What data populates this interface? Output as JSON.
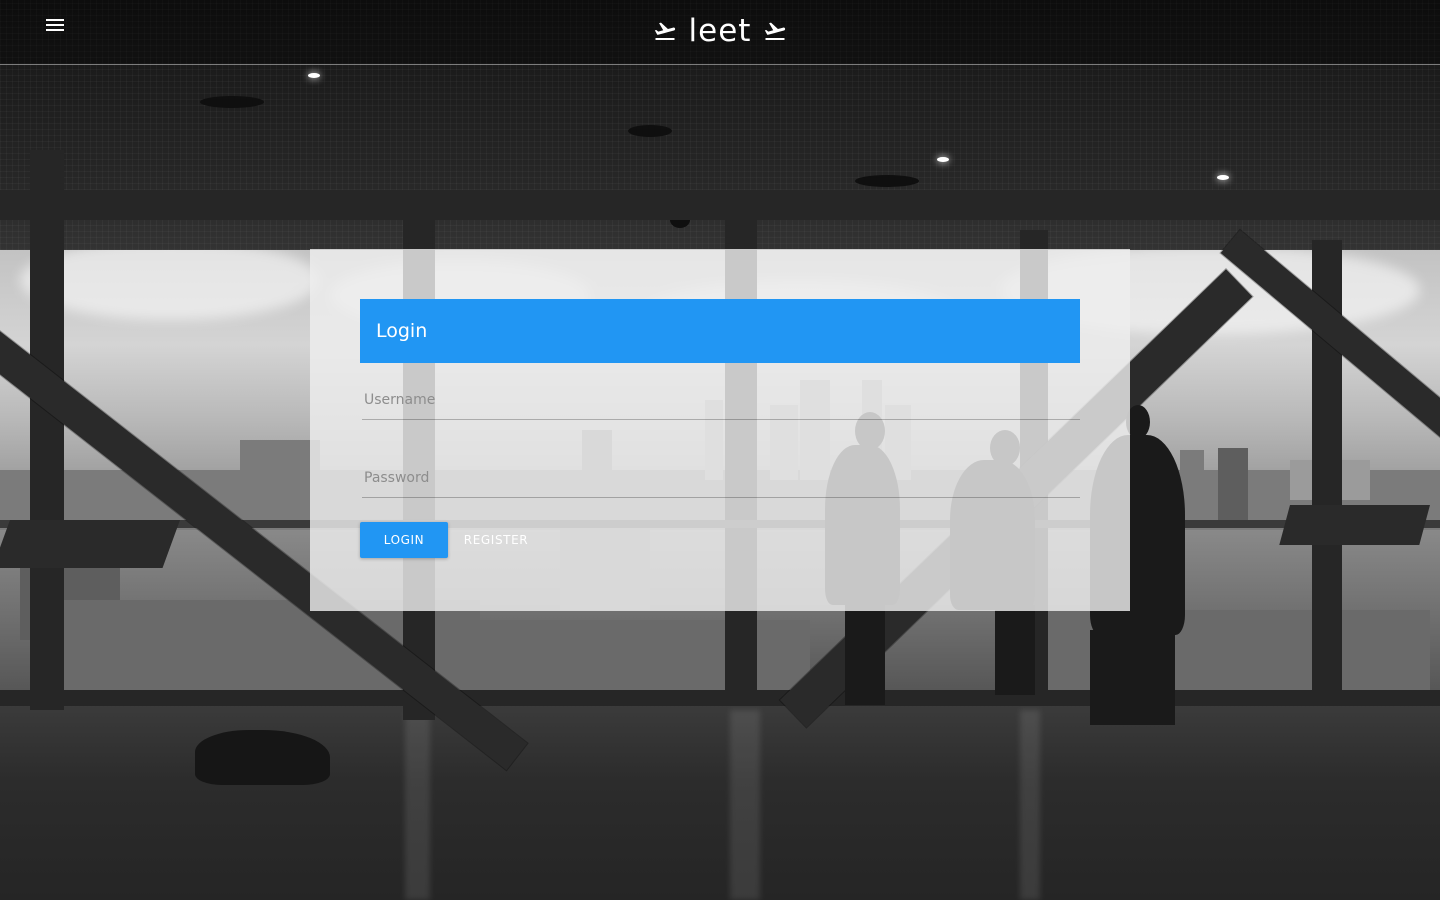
{
  "header": {
    "brand_title": "leet",
    "menu_icon": "hamburger-menu-icon",
    "brand_icon_left": "airplane-takeoff-icon",
    "brand_icon_right": "airplane-takeoff-icon"
  },
  "login_card": {
    "title": "Login",
    "username_placeholder": "Username",
    "password_placeholder": "Password",
    "login_label": "LOGIN",
    "register_label": "REGISTER"
  },
  "colors": {
    "accent": "#2196f3",
    "card_background": "#eeeeee",
    "header_text": "#ffffff"
  }
}
